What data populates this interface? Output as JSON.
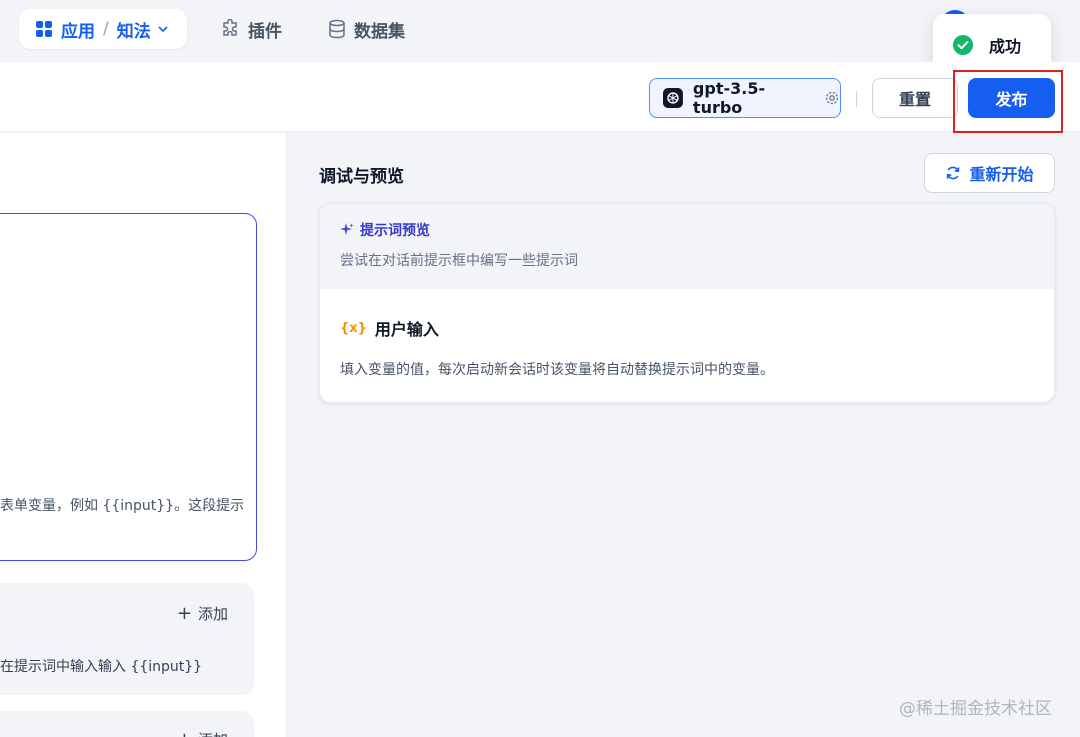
{
  "nav": {
    "apps_label": "应用",
    "separator": "/",
    "current_app": "知法",
    "plugins_label": "插件",
    "datasets_label": "数据集"
  },
  "toast": {
    "message": "成功",
    "color": "#12b76a"
  },
  "header": {
    "model_name": "gpt-3.5-turbo",
    "reset_label": "重置",
    "publish_label": "发布"
  },
  "editor": {
    "prompt_snippet": "表单变量，例如 {{input}}。这段提示",
    "variables": {
      "add_label": "添加",
      "hint": "在提示词中输入输入 {{input}}"
    },
    "second_panel_add_label": "添加"
  },
  "preview": {
    "title": "调试与预览",
    "restart_label": "重新开始",
    "prompt_preview_title": "提示词预览",
    "prompt_preview_desc": "尝试在对话前提示框中编写一些提示词",
    "user_input_badge": "{x}",
    "user_input_title": "用户输入",
    "user_input_desc": "填入变量的值，每次启动新会话时该变量将自动替换提示词中的变量。"
  },
  "watermark": "@稀土掘金技术社区",
  "colors": {
    "primary": "#155eef",
    "highlight": "#e02020",
    "accent_indigo": "#444ce7"
  }
}
